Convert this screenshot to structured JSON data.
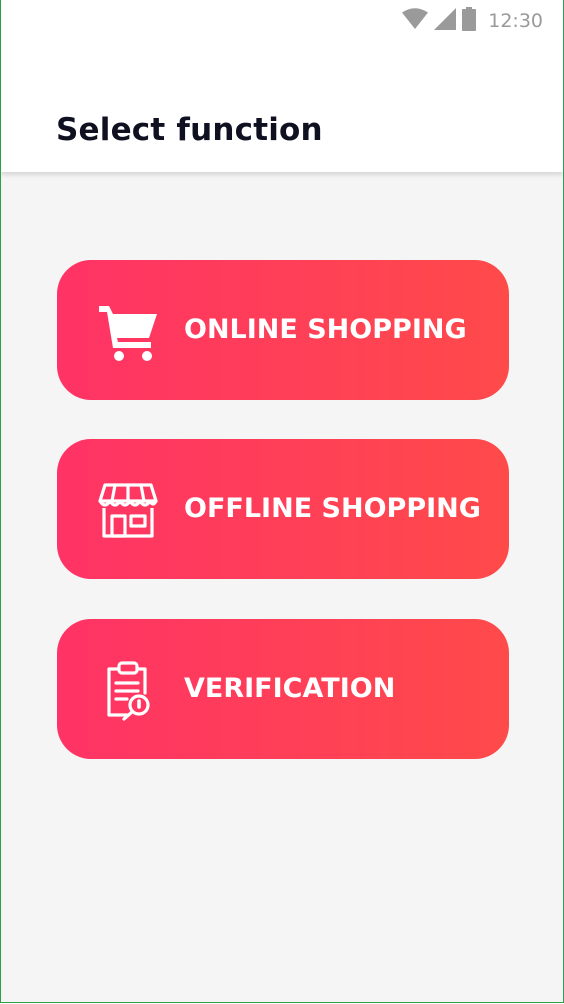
{
  "status_bar": {
    "time": "12:30",
    "icons": [
      "wifi-icon",
      "cell-signal-icon",
      "battery-icon"
    ]
  },
  "app_bar": {
    "title": "Select function"
  },
  "functions": [
    {
      "label": "ONLINE SHOPPING",
      "icon": "shopping-cart-icon"
    },
    {
      "label": "OFFLINE SHOPPING",
      "icon": "storefront-icon"
    },
    {
      "label": "VERIFICATION",
      "icon": "clipboard-search-icon"
    }
  ],
  "colors": {
    "gradient_start": "#ff3366",
    "gradient_end": "#ff4a4a",
    "background": "#f5f5f5",
    "title_text": "#0f1020",
    "status_text": "#9a9a9a"
  }
}
